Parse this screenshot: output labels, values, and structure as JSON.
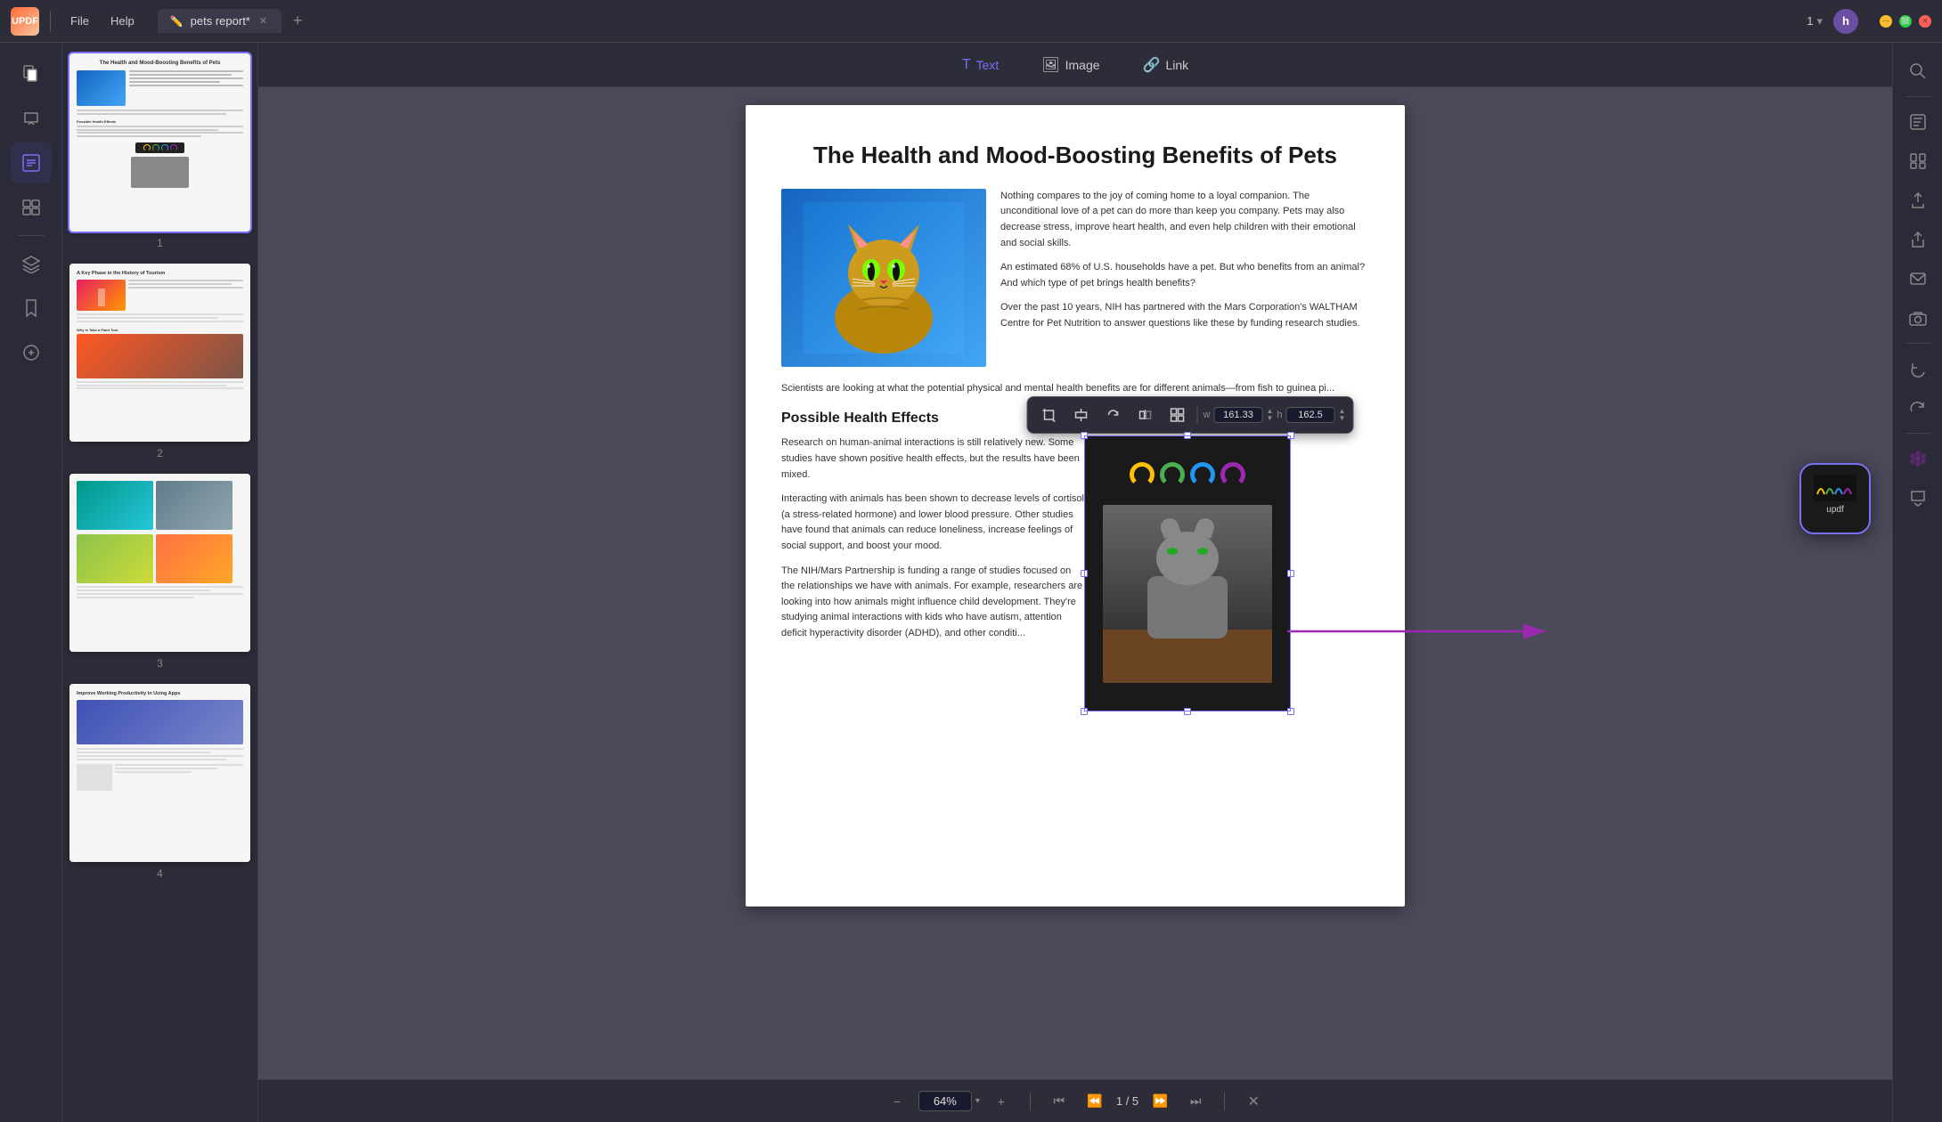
{
  "app": {
    "logo": "UPDF",
    "menu": [
      "File",
      "Help"
    ],
    "tab": {
      "name": "pets report*",
      "icon": "✏️"
    },
    "page_indicator": "1",
    "user_initial": "h"
  },
  "edit_toolbar": {
    "text_label": "Text",
    "image_label": "Image",
    "link_label": "Link"
  },
  "pdf": {
    "title": "The Health and Mood-Boosting Benefits of Pets",
    "paragraphs": [
      "Nothing compares to the joy of coming home to a loyal companion. The unconditional love of a pet can do more than keep you company. Pets may also decrease stress, improve heart health, and even help children with their emotional and social skills.",
      "An estimated 68% of U.S. households have a pet. But who benefits from an animal? And which type of pet brings health benefits?",
      "Over the past 10 years, NIH has partnered with the Mars Corporation's WALTHAM Centre for Pet Nutrition to answer questions like these by funding research studies.",
      "Scientists are looking at what the potential physical and mental health benefits are for different animals—from fish to guinea pi..."
    ],
    "section_title": "Possible Health Effects",
    "section_paragraphs": [
      "Research on human-animal interactions is still relatively new. Some studies have shown positive health effects, but the results have been mixed.",
      "Interacting with animals has been shown to decrease levels of cortisol (a stress-related hormone) and lower blood pressure. Other studies have found that animals can reduce loneliness, increase feelings of social support, and boost your mood.",
      "The NIH/Mars Partnership is funding a range of studies focused on the relationships we have with animals. For example, researchers are looking into how animals might influence child development. They're studying animal interactions with kids who have autism, attention deficit hyperactivity disorder (ADHD), and other conditi..."
    ]
  },
  "image_toolbar": {
    "width_label": "w",
    "width_value": "161.33",
    "height_label": "h",
    "height_value": "162.5"
  },
  "bottom_nav": {
    "zoom_value": "64%",
    "page_current": "1",
    "page_total": "5",
    "page_display": "1 / 5"
  },
  "thumbnails": [
    {
      "number": "1",
      "title": "The Health and Mood-Boosting Benefits of Pets"
    },
    {
      "number": "2",
      "title": "A Key Phase in the History of Tourism"
    },
    {
      "number": "3",
      "title": ""
    },
    {
      "number": "4",
      "title": "Improve Working Productivity in Using Apps"
    }
  ],
  "updf_floating": {
    "label": "updf"
  },
  "right_sidebar_tools": [
    "search",
    "ocr",
    "organize",
    "export",
    "share",
    "email",
    "camera",
    "divider",
    "undo",
    "redo",
    "divider2",
    "flowers",
    "chat"
  ],
  "left_sidebar_tools": [
    "pages",
    "pencil",
    "edit-active",
    "table",
    "layers",
    "bookmark",
    "clip"
  ]
}
